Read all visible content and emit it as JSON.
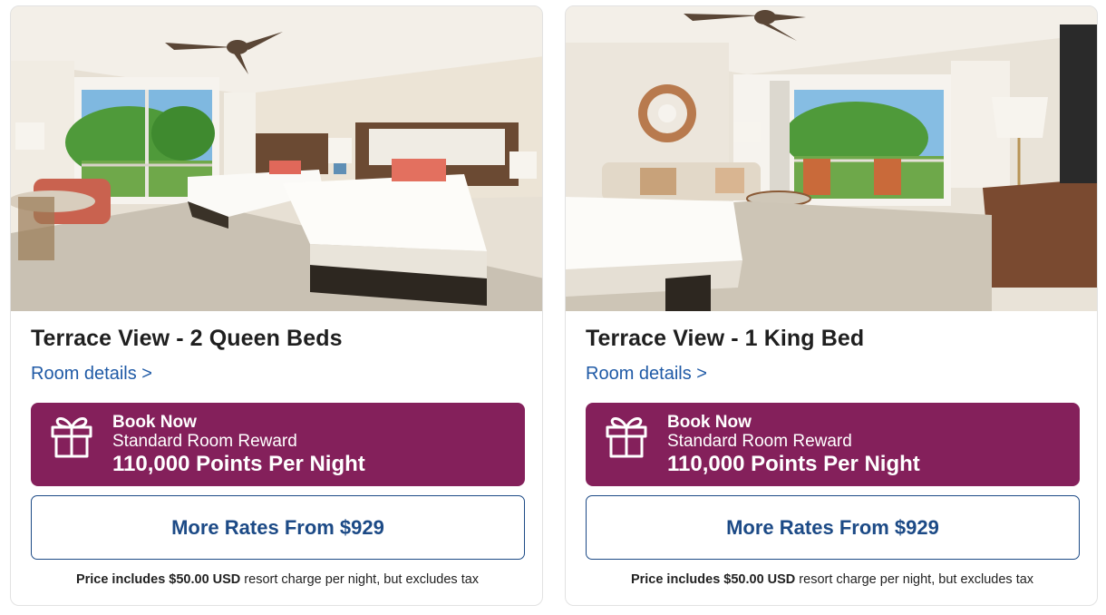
{
  "rooms": [
    {
      "title": "Terrace View - 2 Queen Beds",
      "details_link": "Room details >",
      "book": {
        "line1": "Book Now",
        "line2": "Standard Room Reward",
        "line3": "110,000 Points Per Night",
        "icon": "gift-icon"
      },
      "rates_button": "More Rates From $929",
      "note": {
        "prefix": "Price includes $50.00 USD",
        "suffix": " resort charge per night, but excludes tax"
      }
    },
    {
      "title": "Terrace View - 1 King Bed",
      "details_link": "Room details >",
      "book": {
        "line1": "Book Now",
        "line2": "Standard Room Reward",
        "line3": "110,000 Points Per Night",
        "icon": "gift-icon"
      },
      "rates_button": "More Rates From $929",
      "note": {
        "prefix": "Price includes $50.00 USD",
        "suffix": " resort charge per night, but excludes tax"
      }
    }
  ],
  "colors": {
    "book_bg": "#84205b",
    "link": "#1f5aa6",
    "rates_border": "#1c4a86"
  }
}
